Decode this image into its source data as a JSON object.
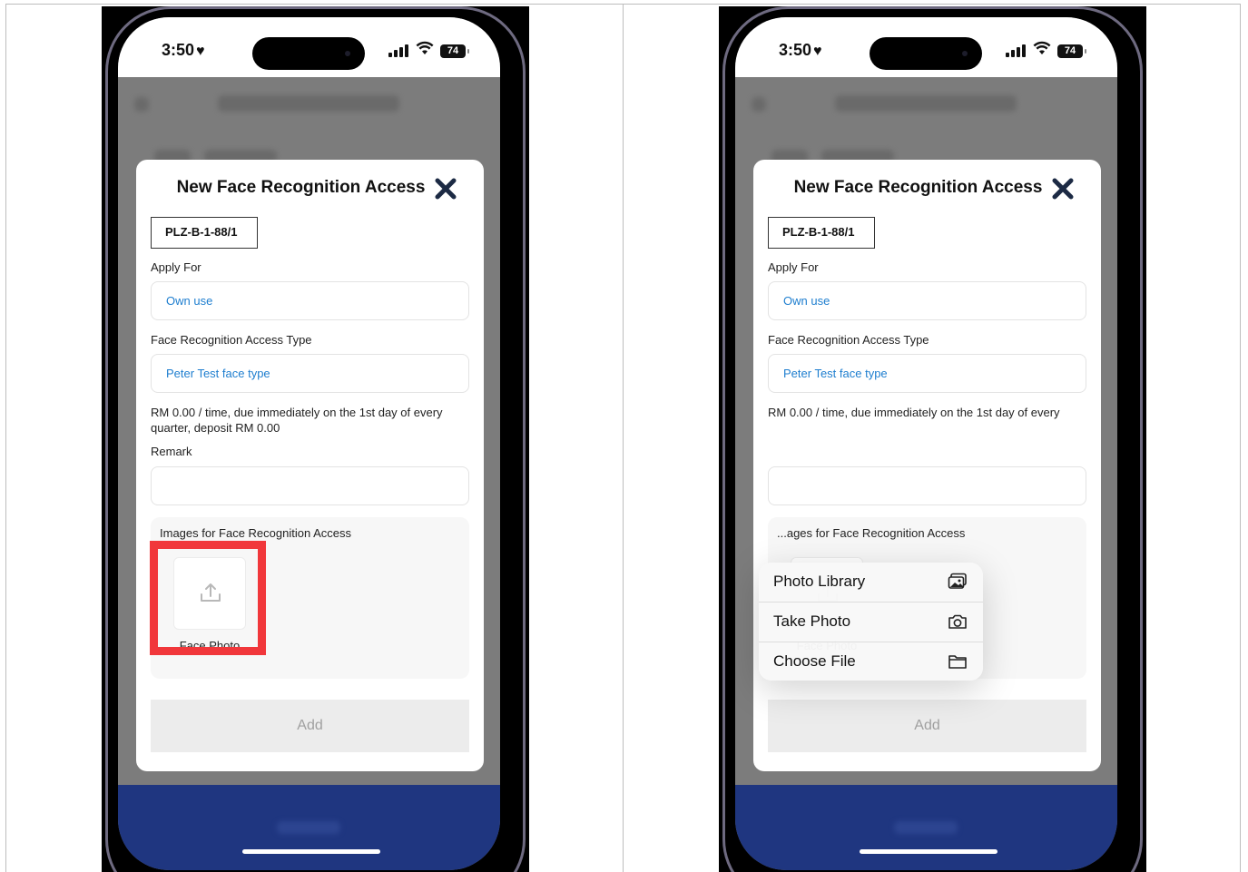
{
  "status": {
    "time": "3:50",
    "battery": "74"
  },
  "modal": {
    "title": "New Face Recognition Access",
    "unit": "PLZ-B-1-88/1",
    "apply_for_label": "Apply For",
    "apply_for_value": "Own use",
    "access_type_label": "Face Recognition Access Type",
    "access_type_value": "Peter Test face type",
    "note": "RM 0.00 / time, due immediately on the 1st day of every quarter, deposit RM 0.00",
    "note_first_line": "RM 0.00 / time, due immediately on the 1st day of every",
    "remark_label": "Remark",
    "images_label": "Images for Face Recognition Access",
    "images_label_partial": "...ages for Face Recognition Access",
    "face_photo_label": "Face Photo",
    "add_label": "Add"
  },
  "menu": {
    "items": [
      {
        "label": "Photo Library",
        "icon": "photo-library-icon"
      },
      {
        "label": "Take Photo",
        "icon": "camera-icon"
      },
      {
        "label": "Choose File",
        "icon": "folder-icon"
      }
    ]
  },
  "colors": {
    "accent": "#1e7ecf",
    "highlight": "#f1373b",
    "bottom_bar": "#1f3680",
    "frame": "#6e6a80"
  }
}
